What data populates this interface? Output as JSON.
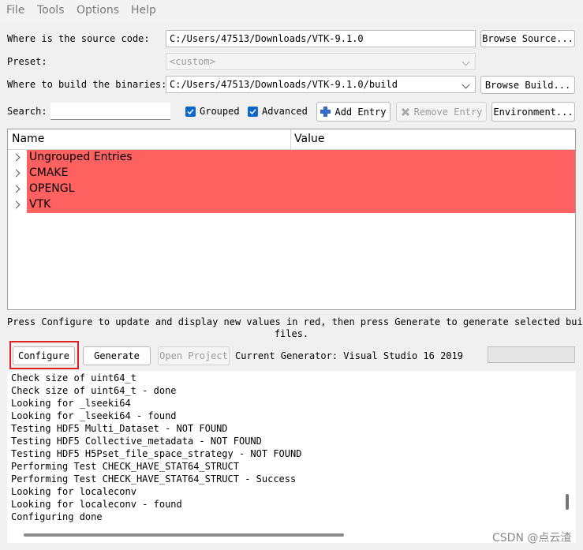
{
  "menu": [
    "File",
    "Tools",
    "Options",
    "Help"
  ],
  "source": {
    "label": "Where is the source code:",
    "value": "C:/Users/47513/Downloads/VTK-9.1.0",
    "button": "Browse Source..."
  },
  "preset": {
    "label": "Preset:",
    "value": "<custom>"
  },
  "build": {
    "label": "Where to build the binaries:",
    "value": "C:/Users/47513/Downloads/VTK-9.1.0/build",
    "button": "Browse Build..."
  },
  "search": {
    "label": "Search:",
    "value": ""
  },
  "options": {
    "grouped": "Grouped",
    "advanced": "Advanced",
    "grouped_checked": true,
    "advanced_checked": true
  },
  "buttons": {
    "add_entry": "Add Entry",
    "remove_entry": "Remove Entry",
    "environment": "Environment..."
  },
  "table": {
    "columns": [
      "Name",
      "Value"
    ],
    "rows": [
      "Ungrouped Entries",
      "CMAKE",
      "OPENGL",
      "VTK"
    ],
    "highlight_color": "#ff6161"
  },
  "hint": {
    "line1": "Press Configure to update and display new values in red, then press Generate to generate selected build",
    "line2": "files."
  },
  "actions": {
    "configure": "Configure",
    "generate": "Generate",
    "open_project": "Open Project",
    "generator": "Current Generator: Visual Studio 16 2019"
  },
  "log": [
    "Check size of uint64_t",
    "Check size of uint64_t - done",
    "Looking for _lseeki64",
    "Looking for _lseeki64 - found",
    "Testing HDF5 Multi_Dataset - NOT FOUND",
    "Testing HDF5 Collective_metadata - NOT FOUND",
    "Testing HDF5 H5Pset_file_space_strategy - NOT FOUND",
    "Performing Test CHECK_HAVE_STAT64_STRUCT",
    "Performing Test CHECK_HAVE_STAT64_STRUCT - Success",
    "Looking for localeconv",
    "Looking for localeconv - found",
    "Configuring done"
  ],
  "watermark": "CSDN @点云渣"
}
